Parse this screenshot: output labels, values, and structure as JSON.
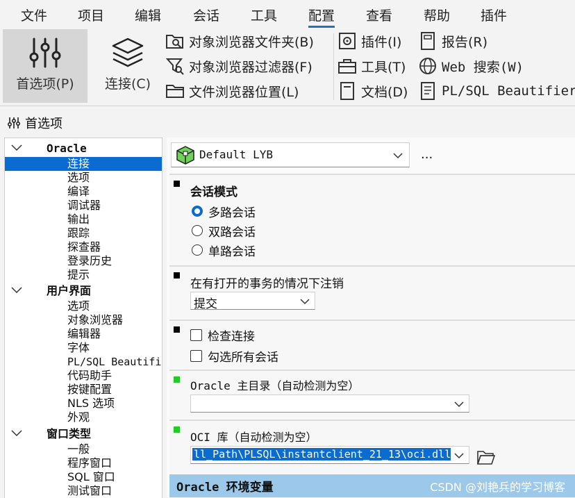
{
  "menubar": {
    "items": [
      "文件",
      "项目",
      "编辑",
      "会话",
      "工具",
      "配置",
      "查看",
      "帮助",
      "插件"
    ],
    "active": "配置"
  },
  "ribbon": {
    "preferences": "首选项(P)",
    "connect": "连接(C)",
    "object_browser_folders": "对象浏览器文件夹(B)",
    "object_browser_filters": "对象浏览器过滤器(F)",
    "file_browser_locations": "文件浏览器位置(L)",
    "plugins": "插件(I)",
    "tools": "工具(T)",
    "documents": "文档(D)",
    "reports": "报告(R)",
    "web_search": "Web 搜索(W)",
    "beautifier": "PL/SQL Beautifier"
  },
  "panel": {
    "title": "首选项"
  },
  "tree": {
    "groups": [
      {
        "label": "Oracle",
        "items": [
          "连接",
          "选项",
          "编译",
          "调试器",
          "输出",
          "跟踪",
          "探查器",
          "登录历史",
          "提示"
        ]
      },
      {
        "label": "用户界面",
        "items": [
          "选项",
          "对象浏览器",
          "编辑器",
          "字体",
          "PL/SQL Beautifi",
          "代码助手",
          "按键配置",
          "NLS 选项",
          "外观"
        ]
      },
      {
        "label": "窗口类型",
        "items": [
          "一般",
          "程序窗口",
          "SQL 窗口",
          "测试窗口"
        ]
      }
    ],
    "selected": "连接"
  },
  "profile": {
    "value": "Default LYB",
    "more": "..."
  },
  "session_mode": {
    "title": "会话模式",
    "options": [
      "多路会话",
      "双路会话",
      "单路会话"
    ],
    "selected": "多路会话"
  },
  "logoff": {
    "title": "在有打开的事务的情况下注销",
    "value": "提交"
  },
  "checks": {
    "check_connection": "检查连接",
    "check_all_sessions": "勾选所有会话"
  },
  "oracle_home": {
    "title": "Oracle 主目录（自动检测为空）",
    "value": ""
  },
  "oci": {
    "title": "OCI 库（自动检测为空）",
    "value": "ll_Path\\PLSQL\\instantclient_21_13\\oci.dll"
  },
  "env": {
    "title": "Oracle 环境变量"
  },
  "watermark": "CSDN @刘艳兵的学习博客",
  "colors": {
    "accent": "#0a6bd1",
    "green_marker": "#22cc22",
    "header_blue": "#9cc9ea"
  }
}
